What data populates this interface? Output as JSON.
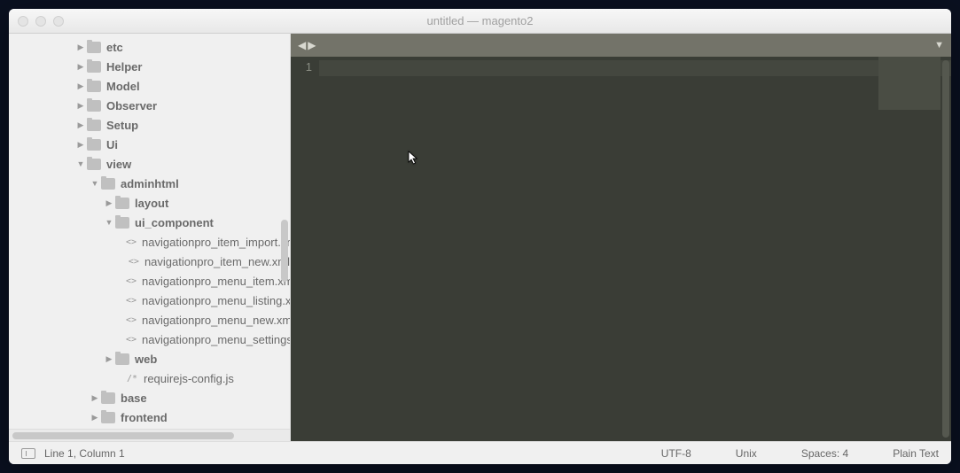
{
  "window": {
    "title": "untitled — magento2"
  },
  "tree": {
    "items": [
      {
        "indent": 76,
        "arrow": "right",
        "type": "folder",
        "label": "etc"
      },
      {
        "indent": 76,
        "arrow": "right",
        "type": "folder",
        "label": "Helper"
      },
      {
        "indent": 76,
        "arrow": "right",
        "type": "folder",
        "label": "Model"
      },
      {
        "indent": 76,
        "arrow": "right",
        "type": "folder",
        "label": "Observer"
      },
      {
        "indent": 76,
        "arrow": "right",
        "type": "folder",
        "label": "Setup"
      },
      {
        "indent": 76,
        "arrow": "right",
        "type": "folder",
        "label": "Ui"
      },
      {
        "indent": 76,
        "arrow": "down",
        "type": "folder",
        "label": "view"
      },
      {
        "indent": 92,
        "arrow": "down",
        "type": "folder",
        "label": "adminhtml"
      },
      {
        "indent": 108,
        "arrow": "right",
        "type": "folder",
        "label": "layout"
      },
      {
        "indent": 108,
        "arrow": "down",
        "type": "folder",
        "label": "ui_component"
      },
      {
        "indent": 130,
        "arrow": "",
        "type": "xml",
        "label": "navigationpro_item_import.xm"
      },
      {
        "indent": 130,
        "arrow": "",
        "type": "xml",
        "label": "navigationpro_item_new.xml"
      },
      {
        "indent": 130,
        "arrow": "",
        "type": "xml",
        "label": "navigationpro_menu_item.xml"
      },
      {
        "indent": 130,
        "arrow": "",
        "type": "xml",
        "label": "navigationpro_menu_listing.xm"
      },
      {
        "indent": 130,
        "arrow": "",
        "type": "xml",
        "label": "navigationpro_menu_new.xml"
      },
      {
        "indent": 130,
        "arrow": "",
        "type": "xml",
        "label": "navigationpro_menu_settings.x"
      },
      {
        "indent": 108,
        "arrow": "right",
        "type": "folder",
        "label": "web"
      },
      {
        "indent": 120,
        "arrow": "",
        "type": "js",
        "label": "requirejs-config.js"
      },
      {
        "indent": 92,
        "arrow": "right",
        "type": "folder",
        "label": "base"
      },
      {
        "indent": 92,
        "arrow": "right",
        "type": "folder",
        "label": "frontend"
      }
    ]
  },
  "editor": {
    "line_number": "1"
  },
  "statusbar": {
    "position": "Line 1, Column 1",
    "encoding": "UTF-8",
    "line_ending": "Unix",
    "indent": "Spaces: 4",
    "syntax": "Plain Text"
  },
  "icons": {
    "xml": "<>",
    "js": "/*"
  }
}
